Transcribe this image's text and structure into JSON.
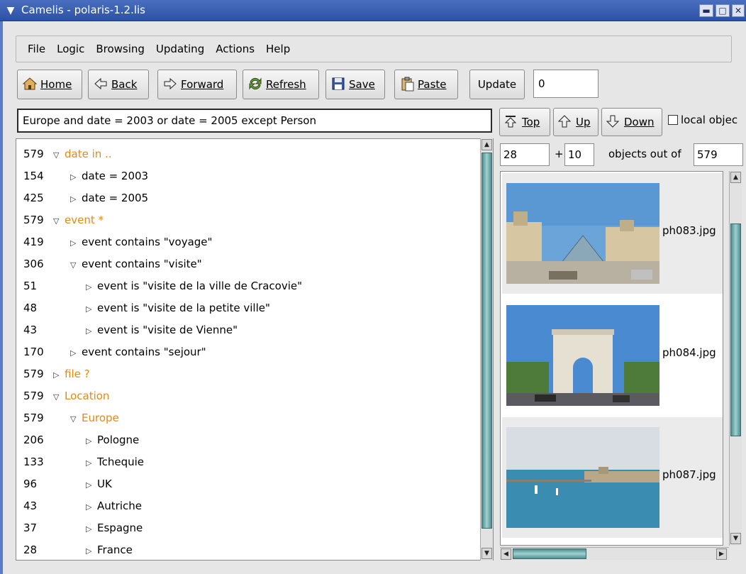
{
  "window": {
    "title": "Camelis - polaris-1.2.lis",
    "controls": [
      "▬",
      "□",
      "✕"
    ]
  },
  "menu": [
    "File",
    "Logic",
    "Browsing",
    "Updating",
    "Actions",
    "Help"
  ],
  "toolbar": {
    "home": "Home",
    "back": "Back",
    "forward": "Forward",
    "refresh": "Refresh",
    "save": "Save",
    "paste": "Paste",
    "update": "Update",
    "update_value": "0"
  },
  "query": {
    "text": "Europe  and date = 2003  or date = 2005  except Person"
  },
  "navigation": {
    "top": "Top",
    "up": "Up",
    "down": "Down",
    "local_objects": "local objec"
  },
  "tree": [
    {
      "count": "579",
      "label": "date in ..",
      "level": 0,
      "expanded": true,
      "orange": true
    },
    {
      "count": "154",
      "label": "date = 2003",
      "level": 1,
      "expanded": false,
      "orange": false
    },
    {
      "count": "425",
      "label": "date = 2005",
      "level": 1,
      "expanded": false,
      "orange": false
    },
    {
      "count": "579",
      "label": "event *",
      "level": 0,
      "expanded": true,
      "orange": true
    },
    {
      "count": "419",
      "label": "event contains \"voyage\"",
      "level": 1,
      "expanded": false,
      "orange": false
    },
    {
      "count": "306",
      "label": "event contains \"visite\"",
      "level": 1,
      "expanded": true,
      "orange": false
    },
    {
      "count": "51",
      "label": "event is \"visite de la ville de Cracovie\"",
      "level": 2,
      "expanded": false,
      "orange": false
    },
    {
      "count": "48",
      "label": "event is \"visite de la petite ville\"",
      "level": 2,
      "expanded": false,
      "orange": false
    },
    {
      "count": "43",
      "label": "event is \"visite de Vienne\"",
      "level": 2,
      "expanded": false,
      "orange": false
    },
    {
      "count": "170",
      "label": "event contains \"sejour\"",
      "level": 1,
      "expanded": false,
      "orange": false
    },
    {
      "count": "579",
      "label": "file ?",
      "level": 0,
      "expanded": false,
      "orange": true
    },
    {
      "count": "579",
      "label": "Location",
      "level": 0,
      "expanded": true,
      "orange": true
    },
    {
      "count": "579",
      "label": "Europe",
      "level": 1,
      "expanded": true,
      "orange": true
    },
    {
      "count": "206",
      "label": "Pologne",
      "level": 2,
      "expanded": false,
      "orange": false
    },
    {
      "count": "133",
      "label": "Tchequie",
      "level": 2,
      "expanded": false,
      "orange": false
    },
    {
      "count": "96",
      "label": "UK",
      "level": 2,
      "expanded": false,
      "orange": false
    },
    {
      "count": "43",
      "label": "Autriche",
      "level": 2,
      "expanded": false,
      "orange": false
    },
    {
      "count": "37",
      "label": "Espagne",
      "level": 2,
      "expanded": false,
      "orange": false
    },
    {
      "count": "28",
      "label": "France",
      "level": 2,
      "expanded": false,
      "orange": false
    }
  ],
  "range": {
    "start": "28",
    "plus": "+",
    "size": "10",
    "label": "objects out of",
    "total": "579"
  },
  "objects": [
    {
      "file": "ph083.jpg",
      "scene": "louvre"
    },
    {
      "file": "ph084.jpg",
      "scene": "arc"
    },
    {
      "file": "ph087.jpg",
      "scene": "harbor"
    }
  ]
}
